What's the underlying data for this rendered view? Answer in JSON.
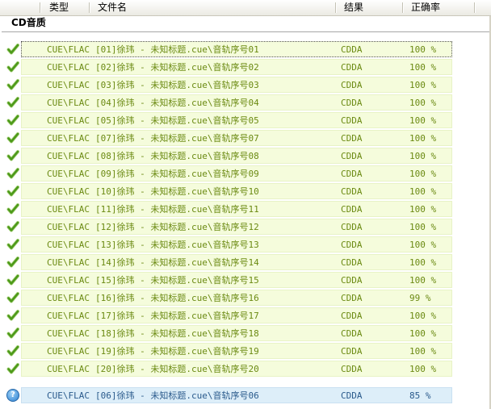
{
  "columns": {
    "type": "类型",
    "filename": "文件名",
    "result": "结果",
    "accuracy": "正确率"
  },
  "section_title": "CD音质",
  "rows": [
    {
      "type": "CUE\\FLAC",
      "filename": "[01]徐玮 - 未知标题.cue\\音轨序号01",
      "result": "CDDA",
      "accuracy": "100 %",
      "status": "ok-icon"
    },
    {
      "type": "CUE\\FLAC",
      "filename": "[02]徐玮 - 未知标题.cue\\音轨序号02",
      "result": "CDDA",
      "accuracy": "100 %",
      "status": "ok-icon"
    },
    {
      "type": "CUE\\FLAC",
      "filename": "[03]徐玮 - 未知标题.cue\\音轨序号03",
      "result": "CDDA",
      "accuracy": "100 %",
      "status": "ok-icon"
    },
    {
      "type": "CUE\\FLAC",
      "filename": "[04]徐玮 - 未知标题.cue\\音轨序号04",
      "result": "CDDA",
      "accuracy": "100 %",
      "status": "ok-icon"
    },
    {
      "type": "CUE\\FLAC",
      "filename": "[05]徐玮 - 未知标题.cue\\音轨序号05",
      "result": "CDDA",
      "accuracy": "100 %",
      "status": "ok-icon"
    },
    {
      "type": "CUE\\FLAC",
      "filename": "[07]徐玮 - 未知标题.cue\\音轨序号07",
      "result": "CDDA",
      "accuracy": "100 %",
      "status": "ok-icon"
    },
    {
      "type": "CUE\\FLAC",
      "filename": "[08]徐玮 - 未知标题.cue\\音轨序号08",
      "result": "CDDA",
      "accuracy": "100 %",
      "status": "ok-icon"
    },
    {
      "type": "CUE\\FLAC",
      "filename": "[09]徐玮 - 未知标题.cue\\音轨序号09",
      "result": "CDDA",
      "accuracy": "100 %",
      "status": "ok-icon"
    },
    {
      "type": "CUE\\FLAC",
      "filename": "[10]徐玮 - 未知标题.cue\\音轨序号10",
      "result": "CDDA",
      "accuracy": "100 %",
      "status": "ok-icon"
    },
    {
      "type": "CUE\\FLAC",
      "filename": "[11]徐玮 - 未知标题.cue\\音轨序号11",
      "result": "CDDA",
      "accuracy": "100 %",
      "status": "ok-icon"
    },
    {
      "type": "CUE\\FLAC",
      "filename": "[12]徐玮 - 未知标题.cue\\音轨序号12",
      "result": "CDDA",
      "accuracy": "100 %",
      "status": "ok-icon"
    },
    {
      "type": "CUE\\FLAC",
      "filename": "[13]徐玮 - 未知标题.cue\\音轨序号13",
      "result": "CDDA",
      "accuracy": "100 %",
      "status": "ok-icon"
    },
    {
      "type": "CUE\\FLAC",
      "filename": "[14]徐玮 - 未知标题.cue\\音轨序号14",
      "result": "CDDA",
      "accuracy": "100 %",
      "status": "ok-icon"
    },
    {
      "type": "CUE\\FLAC",
      "filename": "[15]徐玮 - 未知标题.cue\\音轨序号15",
      "result": "CDDA",
      "accuracy": "100 %",
      "status": "ok-icon"
    },
    {
      "type": "CUE\\FLAC",
      "filename": "[16]徐玮 - 未知标题.cue\\音轨序号16",
      "result": "CDDA",
      "accuracy": "99 %",
      "status": "ok-icon"
    },
    {
      "type": "CUE\\FLAC",
      "filename": "[17]徐玮 - 未知标题.cue\\音轨序号17",
      "result": "CDDA",
      "accuracy": "100 %",
      "status": "ok-icon"
    },
    {
      "type": "CUE\\FLAC",
      "filename": "[18]徐玮 - 未知标题.cue\\音轨序号18",
      "result": "CDDA",
      "accuracy": "100 %",
      "status": "ok-icon"
    },
    {
      "type": "CUE\\FLAC",
      "filename": "[19]徐玮 - 未知标题.cue\\音轨序号19",
      "result": "CDDA",
      "accuracy": "100 %",
      "status": "ok-icon"
    },
    {
      "type": "CUE\\FLAC",
      "filename": "[20]徐玮 - 未知标题.cue\\音轨序号20",
      "result": "CDDA",
      "accuracy": "100 %",
      "status": "ok-icon"
    },
    {
      "type": "CUE\\FLAC",
      "filename": "[06]徐玮 - 未知标题.cue\\音轨序号06",
      "result": "CDDA",
      "accuracy": "85 %",
      "status": "question-icon"
    }
  ],
  "pending_icon_glyph": "?",
  "colors": {
    "ok_row_bg": "#f5fcdc",
    "ok_text": "#6b8a12",
    "pending_row_bg": "#ddeef9",
    "pending_text": "#2a5a8c",
    "check_green": "#4d9a1a"
  }
}
